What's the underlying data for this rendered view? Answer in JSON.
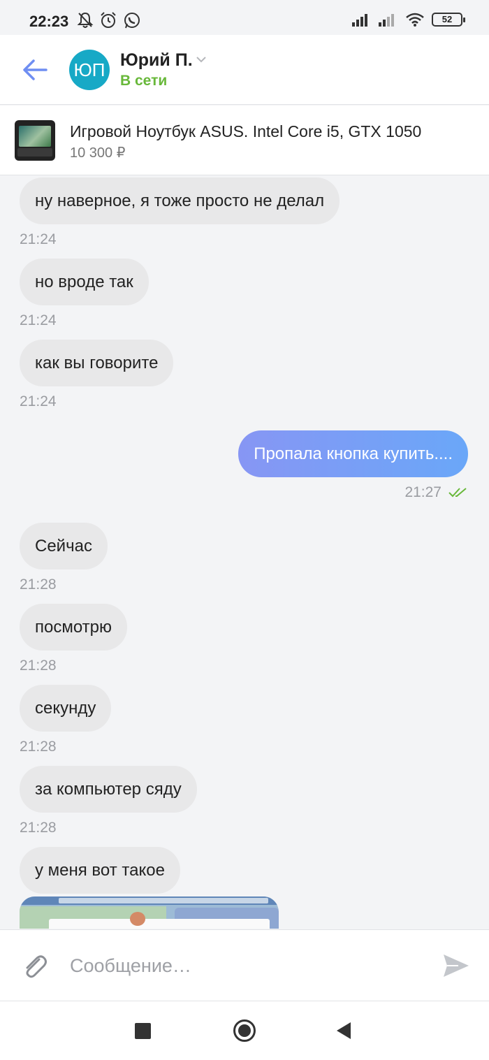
{
  "status_bar": {
    "time": "22:23",
    "battery": "52"
  },
  "header": {
    "avatar_initials": "ЮП",
    "contact_name": "Юрий П.",
    "contact_status": "В сети",
    "accent": "#6f8ef2",
    "avatar_color": "#17a9c6",
    "status_color": "#68b83a"
  },
  "listing": {
    "title": "Игровой Ноутбук ASUS. Intel Core i5, GTX 1050",
    "price": "10 300 ₽"
  },
  "messages": [
    {
      "dir": "in",
      "text": "ну наверное, я тоже просто не делал",
      "time": "21:24"
    },
    {
      "dir": "in",
      "text": "но вроде так",
      "time": "21:24"
    },
    {
      "dir": "in",
      "text": "как вы говорите",
      "time": "21:24"
    },
    {
      "dir": "out",
      "text": "Пропала кнопка купить....",
      "time": "21:27",
      "read": true
    },
    {
      "dir": "in",
      "text": "Сейчас",
      "time": "21:28"
    },
    {
      "dir": "in",
      "text": "посмотрю",
      "time": "21:28"
    },
    {
      "dir": "in",
      "text": "секунду",
      "time": "21:28"
    },
    {
      "dir": "in",
      "text": "за компьютер сяду",
      "time": "21:28"
    },
    {
      "dir": "in",
      "text": "у меня вот такое"
    }
  ],
  "composer": {
    "placeholder": "Сообщение…"
  },
  "icons": {
    "back": "arrow-left-icon",
    "attach": "paperclip-icon",
    "send": "send-icon",
    "read_receipt": "double-check-icon"
  },
  "colors": {
    "outgoing_gradient_start": "#8796f4",
    "outgoing_gradient_end": "#6aa7f8",
    "incoming_bubble": "#e8e8e9",
    "read_check": "#68b83a"
  }
}
